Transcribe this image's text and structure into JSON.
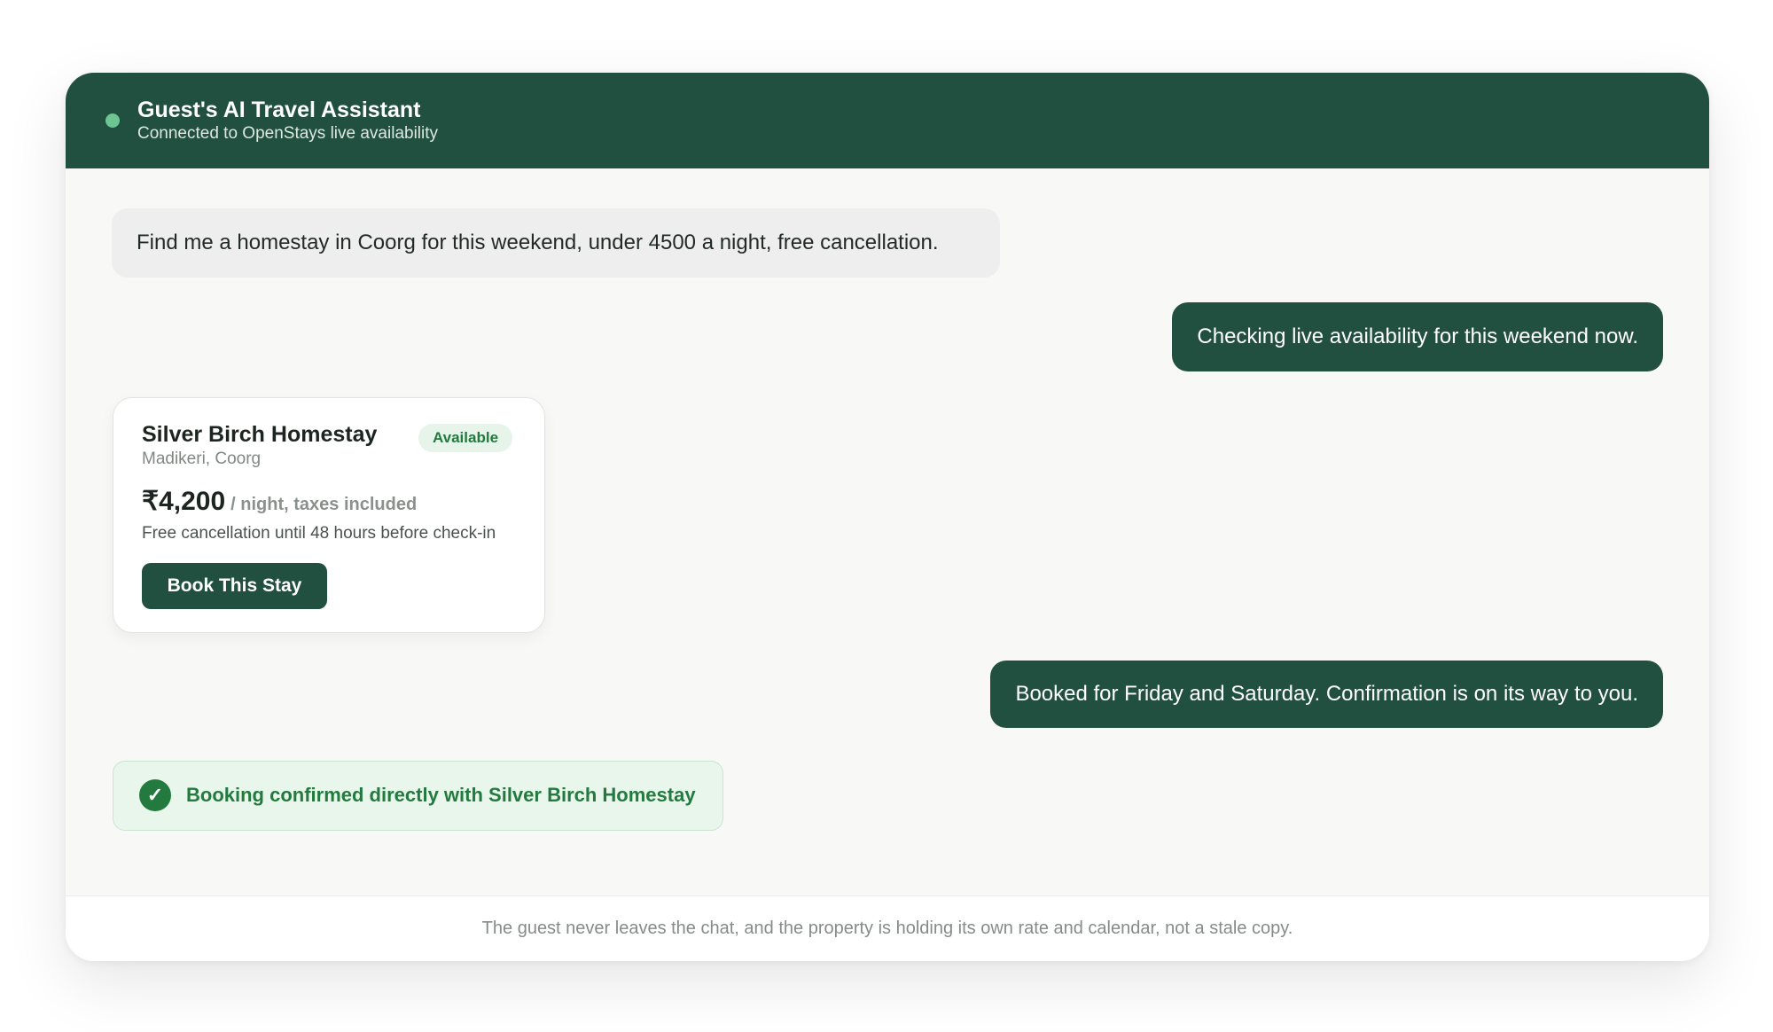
{
  "colors": {
    "brand": "#225040",
    "status_dot": "#6cc592",
    "success": "#237a3f",
    "success_bg": "#e9f6ec"
  },
  "header": {
    "title": "Guest's AI Travel Assistant",
    "subtitle": "Connected to OpenStays live availability",
    "status_icon": "online-dot-icon"
  },
  "messages": [
    {
      "role": "user",
      "text": "Find me a homestay in Coorg for this weekend, under 4500 a night, free cancellation."
    },
    {
      "role": "assistant",
      "text": "Checking live availability for this weekend now."
    },
    {
      "role": "assistant",
      "text": "Booked for Friday and Saturday. Confirmation is on its way to you."
    }
  ],
  "listing": {
    "name": "Silver Birch Homestay",
    "badge": "Available",
    "location": "Madikeri, Coorg",
    "price": "₹4,200",
    "price_unit": "/ night, taxes included",
    "cancellation": "Free cancellation until 48 hours before check-in",
    "book_label": "Book This Stay"
  },
  "confirmation": {
    "icon": "check-circle-icon",
    "icon_glyph": "✓",
    "text": "Booking confirmed directly with Silver Birch Homestay"
  },
  "footer": {
    "text": "The guest never leaves the chat, and the property is holding its own rate and calendar, not a stale copy."
  }
}
